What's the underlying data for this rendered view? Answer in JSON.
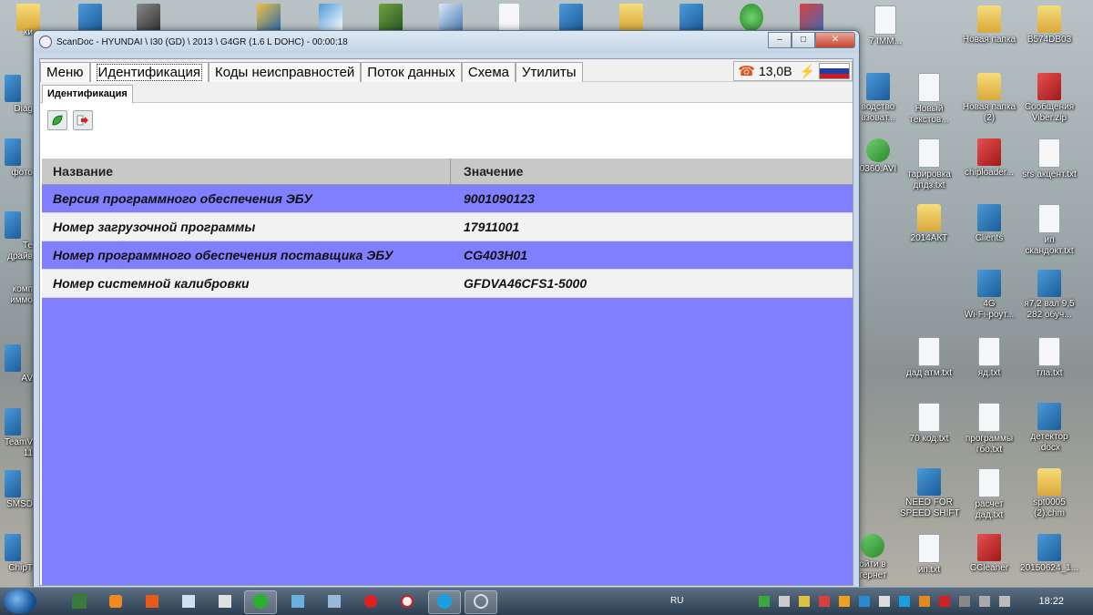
{
  "window": {
    "title": "ScanDoc - HYUNDAI \\ I30 (GD) \\ 2013 \\ G4GR (1.6 L DOHC) - 00:00:18",
    "minimize": "–",
    "maximize": "□",
    "close": "✕"
  },
  "menu": {
    "tabs": [
      {
        "label": "Меню"
      },
      {
        "label": "Идентификация"
      },
      {
        "label": "Коды неисправностей"
      },
      {
        "label": "Поток данных"
      },
      {
        "label": "Схема"
      },
      {
        "label": "Утилиты"
      }
    ],
    "voltage": "13,0В",
    "phone_glyph": "☎",
    "plug_glyph": "⚡"
  },
  "subtab": {
    "label": "Идентификация"
  },
  "toolbar": {
    "refresh_icon": "leaf-icon",
    "exit_icon": "exit-icon"
  },
  "table": {
    "headers": [
      "Название",
      "Значение"
    ],
    "rows": [
      [
        "Версия программного обеспечения ЭБУ",
        "9001090123"
      ],
      [
        "Номер загрузочной программы",
        "17911001"
      ],
      [
        "Номер программного обеспечения поставщика ЭБУ",
        "CG403H01"
      ],
      [
        "Номер системной калибровки",
        "GFDVA46CFS1-5000"
      ]
    ]
  },
  "desktop": {
    "icons": [
      {
        "label": "Новая папка"
      },
      {
        "label": "B574DB03"
      },
      {
        "label": "водство\nвзоват..."
      },
      {
        "label": "Новый\nтекстов..."
      },
      {
        "label": "Новая папка\n(2)"
      },
      {
        "label": "Сообщения\nViber.zip"
      },
      {
        "label": "0360.AVI"
      },
      {
        "label": "тарировка\nдпдз.txt"
      },
      {
        "label": "chiploader..."
      },
      {
        "label": "srs акцент.txt"
      },
      {
        "label": "2014АКТ"
      },
      {
        "label": "Clients"
      },
      {
        "label": "ип\nскандокт.txt"
      },
      {
        "label": "4G\nWi-Fi-роут..."
      },
      {
        "label": "я7,2 вал 9,5\n282 обуч..."
      },
      {
        "label": "дад атм.txt"
      },
      {
        "label": "яд.txt"
      },
      {
        "label": "тла.txt"
      },
      {
        "label": "70 код.txt"
      },
      {
        "label": "программы\nгбо.txt"
      },
      {
        "label": "детектор\n.docx"
      },
      {
        "label": "NEED FOR\nSPEED SHIFT"
      },
      {
        "label": "расчет\nдад.txt"
      },
      {
        "label": "spt0005\n(2).chm"
      },
      {
        "label": "ойти в\nтернет"
      },
      {
        "label": "ип.txt"
      },
      {
        "label": "CCleaner"
      },
      {
        "label": "20150624_1..."
      },
      {
        "label": "7 IMM..."
      }
    ],
    "left_labels": [
      "ки",
      "Diag",
      "фото",
      "Те\nдрайв",
      "комп\nиммо",
      "AV",
      "TeamV\n11",
      "SMSD",
      "ChipT"
    ]
  },
  "taskbar": {
    "language": "RU",
    "time": "18:22"
  },
  "colors": {
    "row_blue": "#7f7fff",
    "row_light": "#f2f2f2"
  }
}
